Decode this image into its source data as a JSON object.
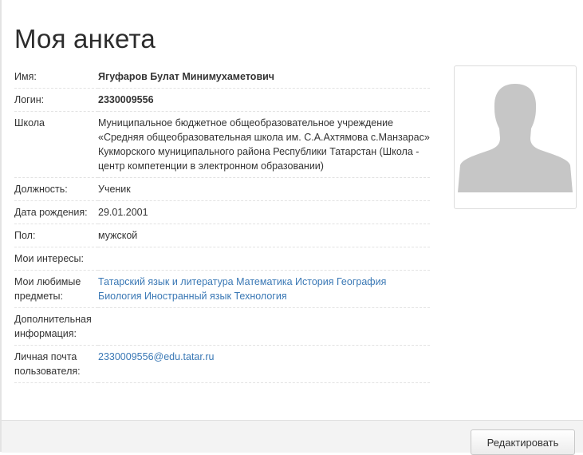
{
  "page": {
    "title": "Моя анкета"
  },
  "profile": {
    "rows": [
      {
        "label": "Имя:",
        "value": "Ягуфаров Булат Минимухаметович"
      },
      {
        "label": "Логин:",
        "value": "2330009556"
      },
      {
        "label": "Школа",
        "value": "Муниципальное бюджетное общеобразовательное учреждение «Средняя общеобразовательная школа им. С.А.Ахтямова с.Манзарас» Кукморского муниципального района Республики Татарстан (Школа - центр компетенции в электронном образовании)"
      },
      {
        "label": "Должность:",
        "value": "Ученик"
      },
      {
        "label": "Дата рождения:",
        "value": "29.01.2001"
      },
      {
        "label": "Пол:",
        "value": "мужской"
      },
      {
        "label": "Мои интересы:",
        "value": ""
      },
      {
        "label": "Мои любимые предметы:",
        "subjects": [
          "Татарский язык и литература",
          "Математика",
          "История",
          "География",
          "Биология",
          "Иностранный язык",
          "Технология"
        ]
      },
      {
        "label": "Дополнительная информация:",
        "value": ""
      },
      {
        "label": "Личная почта пользователя:",
        "value": "2330009556@edu.tatar.ru"
      }
    ]
  },
  "photo": {
    "icon": "user-silhouette-icon"
  },
  "footer": {
    "edit_label": "Редактировать"
  }
}
